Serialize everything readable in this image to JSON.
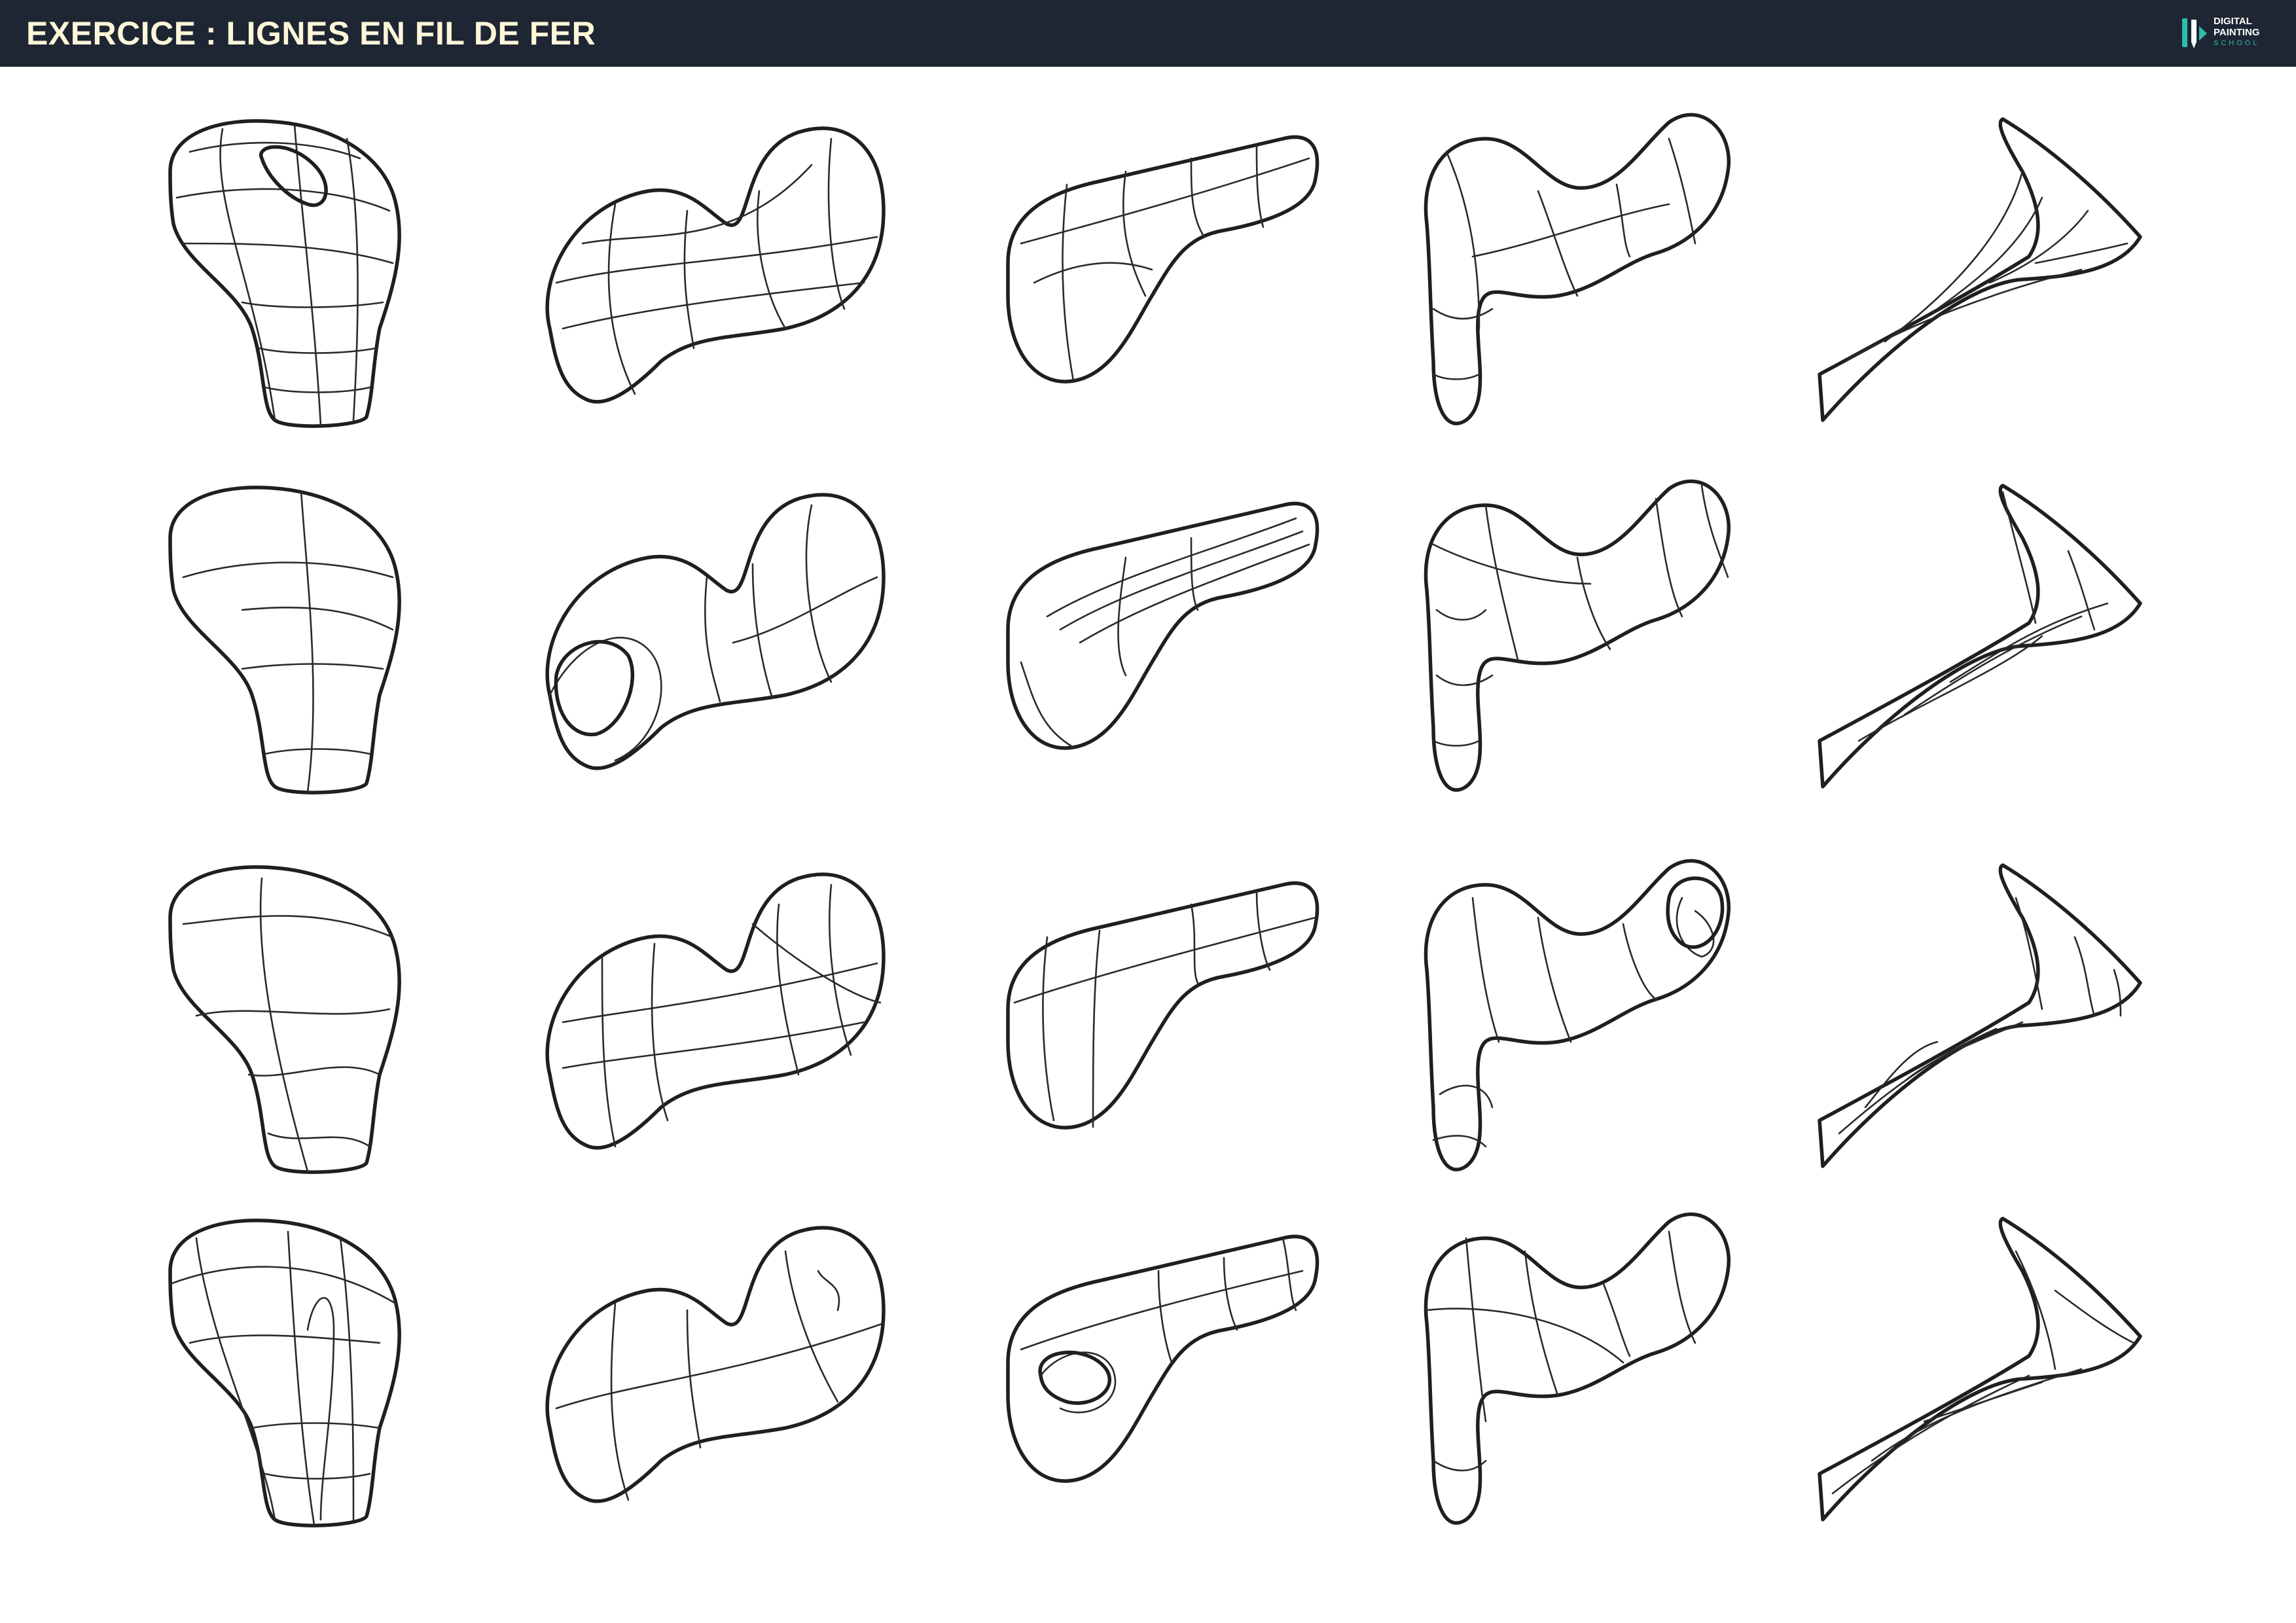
{
  "header": {
    "title": "EXERCICE : LIGNES EN FIL DE FER",
    "logo": {
      "lines": [
        "DIGITAL",
        "PAINTING",
        "SCHOOL"
      ],
      "icon": "pen-brush-logo-icon",
      "accent_color": "#2bbfa8"
    },
    "background_color": "#1e2533",
    "title_color": "#fdf6d8"
  },
  "board": {
    "rows": 4,
    "columns": 5,
    "columns_shapes": [
      "knob",
      "peanut",
      "capsule",
      "s-curve",
      "wedge"
    ],
    "line_color": "#1f1f1f"
  }
}
